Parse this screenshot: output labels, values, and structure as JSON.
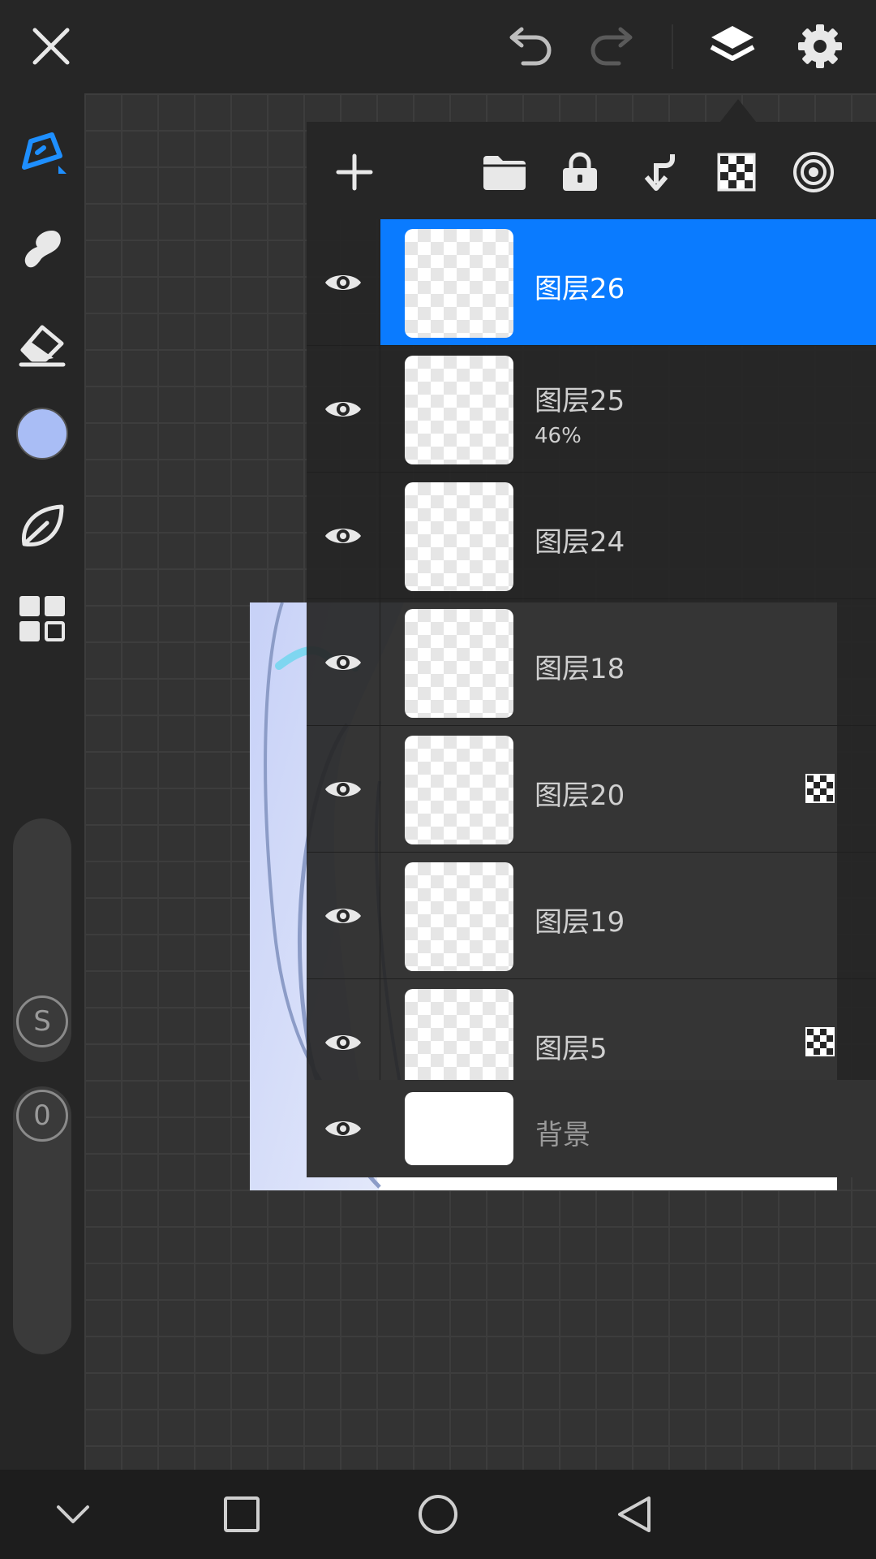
{
  "colors": {
    "accent": "#0a7bff",
    "current_color": "#a9bdf5"
  },
  "topbar": {
    "icons": [
      "close-icon",
      "undo-icon",
      "redo-icon",
      "layers-icon",
      "settings-icon"
    ]
  },
  "toolbar": {
    "tools": [
      "pen-icon",
      "smudge-icon",
      "eraser-icon",
      "color-swatch",
      "blend-leaf-icon",
      "materials-grid-icon"
    ],
    "size_slider_label": "S",
    "opacity_slider_label": "0"
  },
  "layers_panel": {
    "actions": [
      "add-layer-icon",
      "folder-icon",
      "lock-icon",
      "merge-down-icon",
      "checker-icon",
      "radial-icon"
    ],
    "layers": [
      {
        "name": "图层26",
        "opacity": "",
        "selected": true,
        "clipping": false
      },
      {
        "name": "图层25",
        "opacity": "46%",
        "selected": false,
        "clipping": false
      },
      {
        "name": "图层24",
        "opacity": "",
        "selected": false,
        "clipping": false
      },
      {
        "name": "图层18",
        "opacity": "",
        "selected": false,
        "clipping": false
      },
      {
        "name": "图层20",
        "opacity": "",
        "selected": false,
        "clipping": true
      },
      {
        "name": "图层19",
        "opacity": "",
        "selected": false,
        "clipping": false
      },
      {
        "name": "图层5",
        "opacity": "",
        "selected": false,
        "clipping": true
      }
    ],
    "background_layer": "背景"
  },
  "navbar": {
    "icons": [
      "chevron-down-icon",
      "recents-square-icon",
      "home-circle-icon",
      "back-triangle-icon"
    ]
  }
}
